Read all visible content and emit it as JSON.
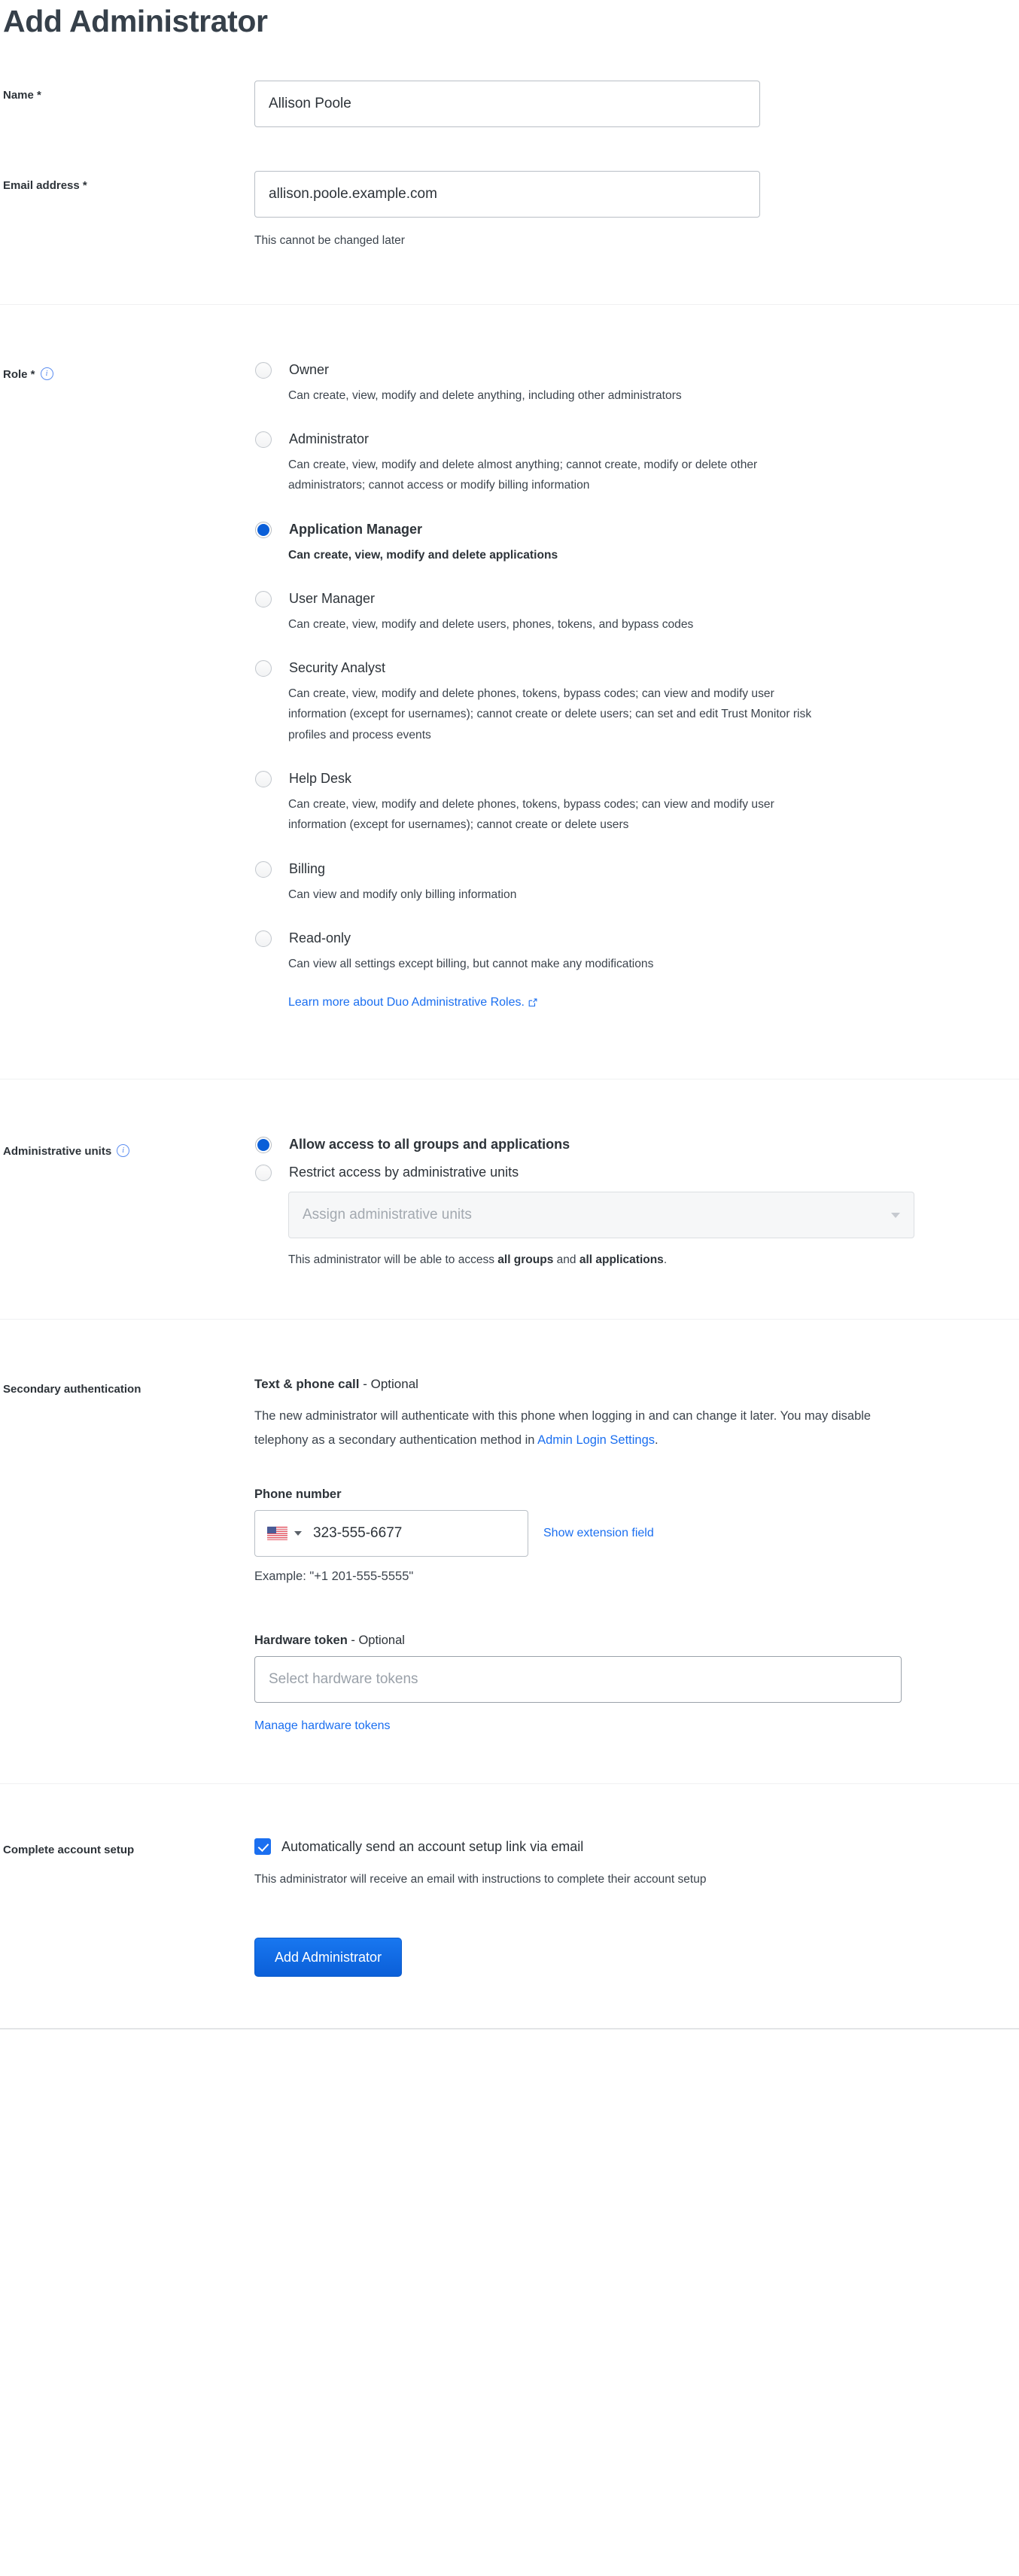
{
  "page": {
    "title": "Add Administrator"
  },
  "name_field": {
    "label": "Name *",
    "value": "Allison Poole",
    "placeholder": ""
  },
  "email_field": {
    "label": "Email address *",
    "value": "allison.poole.example.com",
    "placeholder": "",
    "helper": "This cannot be changed later"
  },
  "role": {
    "label": "Role *",
    "info_icon": "info-icon",
    "selected": "Application Manager",
    "options": [
      {
        "title": "Owner",
        "description": "Can create, view, modify and delete anything, including other administrators",
        "selected": false
      },
      {
        "title": "Administrator",
        "description": "Can create, view, modify and delete almost anything; cannot create, modify or delete other administrators; cannot access or modify billing information",
        "selected": false
      },
      {
        "title": "Application Manager",
        "description": "Can create, view, modify and delete applications",
        "selected": true
      },
      {
        "title": "User Manager",
        "description": "Can create, view, modify and delete users, phones, tokens, and bypass codes",
        "selected": false
      },
      {
        "title": "Security Analyst",
        "description": "Can create, view, modify and delete phones, tokens, bypass codes; can view and modify user information (except for usernames); cannot create or delete users; can set and edit Trust Monitor risk profiles and process events",
        "selected": false
      },
      {
        "title": "Help Desk",
        "description": "Can create, view, modify and delete phones, tokens, bypass codes; can view and modify user information (except for usernames); cannot create or delete users",
        "selected": false
      },
      {
        "title": "Billing",
        "description": "Can view and modify only billing information",
        "selected": false
      },
      {
        "title": "Read-only",
        "description": "Can view all settings except billing, but cannot make any modifications",
        "selected": false
      }
    ],
    "learn_more_link": "Learn more about Duo Administrative Roles.",
    "learn_more_icon": "external-link-icon"
  },
  "admin_units": {
    "label": "Administrative units",
    "info_icon": "info-icon",
    "options": [
      {
        "title": "Allow access to all groups and applications",
        "selected": true
      },
      {
        "title": "Restrict access by administrative units",
        "selected": false
      }
    ],
    "select_placeholder": "Assign administrative units",
    "note_prefix": "This administrator will be able to access ",
    "note_bold_1": "all groups",
    "note_mid": " and ",
    "note_bold_2": "all applications",
    "note_suffix": "."
  },
  "secondary_auth": {
    "label": "Secondary authentication",
    "heading_bold": "Text & phone call",
    "heading_rest": " - Optional",
    "paragraph_part1": "The new administrator will authenticate with this phone when logging in and can change it later. You may disable telephony as a secondary authentication method in ",
    "paragraph_link": "Admin Login Settings",
    "paragraph_part2": ".",
    "phone_label": "Phone number",
    "phone_country_icon": "us-flag-icon",
    "phone_value": "323-555-6677",
    "show_extension_link": "Show extension field",
    "phone_example": "Example: \"+1 201-555-5555\"",
    "hardware_token_label_bold": "Hardware token",
    "hardware_token_label_rest": " - Optional",
    "hardware_token_placeholder": "Select hardware tokens",
    "manage_tokens_link": "Manage hardware tokens"
  },
  "account_setup": {
    "label": "Complete account setup",
    "checkbox_checked": true,
    "checkbox_label": "Automatically send an account setup link via email",
    "helper": "This administrator will receive an email with instructions to complete their account setup"
  },
  "submit": {
    "label": "Add Administrator"
  },
  "colors": {
    "accent_blue": "#1b6ff0",
    "link_blue": "#1b6ff0",
    "radio_selected": "#0b5fd8",
    "text": "#2d3339",
    "divider": "#f0f1f2"
  }
}
